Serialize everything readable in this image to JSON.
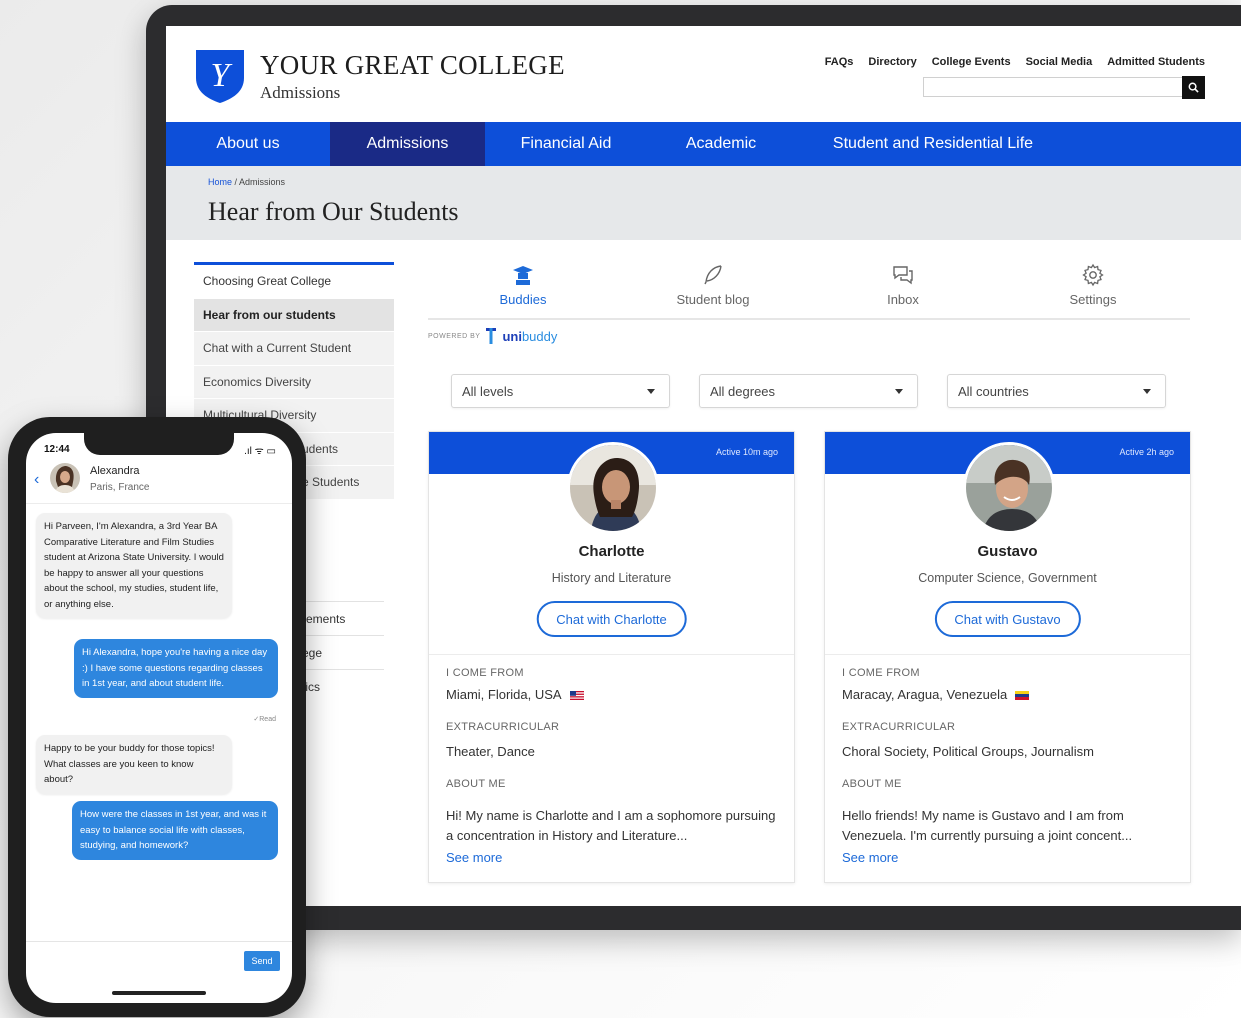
{
  "college": {
    "name": "YOUR GREAT COLLEGE",
    "subtitle": "Admissions",
    "logo_letter": "Y"
  },
  "utility_links": [
    "FAQs",
    "Directory",
    "College Events",
    "Social Media",
    "Admitted Students"
  ],
  "search": {
    "placeholder": ""
  },
  "nav": {
    "items": [
      "About us",
      "Admissions",
      "Financial Aid",
      "Academic",
      "Student and Residential Life"
    ],
    "active": "Admissions"
  },
  "breadcrumb": {
    "home": "Home",
    "current": "/ Admissions"
  },
  "page_title": "Hear from Our Students",
  "sidebar": {
    "items": [
      "Choosing Great College",
      "Hear from our students",
      "Chat with a Current Student",
      "Economics Diversity",
      "Multicultural Diversity",
      "udents",
      "e Students"
    ],
    "lower_items": [
      "rements",
      "ege",
      "tics"
    ]
  },
  "tabs": [
    {
      "label": "Buddies",
      "icon": "graduate-icon"
    },
    {
      "label": "Student blog",
      "icon": "feather-icon"
    },
    {
      "label": "Inbox",
      "icon": "chat-bubbles-icon"
    },
    {
      "label": "Settings",
      "icon": "gear-icon"
    }
  ],
  "powered_by": {
    "label": "POWERED BY",
    "brand_bold": "uni",
    "brand_rest": "buddy"
  },
  "filters": [
    "All levels",
    "All degrees",
    "All countries"
  ],
  "buddies": [
    {
      "name": "Charlotte",
      "subject": "History and Literature",
      "status": "Active 10m ago",
      "chat_label": "Chat with Charlotte",
      "from_label": "I COME FROM",
      "from": "Miami, Florida, USA",
      "flag": "us-flag-icon",
      "extra_label": "EXTRACURRICULAR",
      "extracurricular": "Theater, Dance",
      "about_label": "ABOUT ME",
      "about": "Hi! My name is Charlotte and I am a sophomore pursuing a concentration in History and Literature...",
      "see_more": "See more"
    },
    {
      "name": "Gustavo",
      "subject": "Computer Science, Government",
      "status": "Active 2h ago",
      "chat_label": "Chat with Gustavo",
      "from_label": "I COME FROM",
      "from": "Maracay, Aragua, Venezuela",
      "flag": "venezuela-flag-icon",
      "extra_label": "EXTRACURRICULAR",
      "extracurricular": "Choral Society, Political Groups, Journalism",
      "about_label": "ABOUT ME",
      "about": "Hello friends! My name is Gustavo and I am from Venezuela. I'm currently pursuing a joint concent...",
      "see_more": "See more"
    }
  ],
  "phone": {
    "time": "12:44",
    "status_icons": ".ıl ᯤ ▭",
    "contact_name": "Alexandra",
    "contact_location": "Paris, France",
    "messages": [
      {
        "from": "in",
        "text": "Hi Parveen, I'm Alexandra, a 3rd Year BA Comparative Literature and Film Studies student at Arizona State University. I would be happy to answer all your questions about the school, my studies, student life, or anything else."
      },
      {
        "from": "out",
        "text": "Hi Alexandra, hope you're having a nice day :) I have some questions regarding classes in 1st year, and about student life."
      },
      {
        "from": "in",
        "text": "Happy to be your buddy for those topics! What classes are you keen to know about?"
      },
      {
        "from": "out",
        "text": "How were the classes in 1st year, and was it easy to balance social life with classes, studying, and homework?"
      }
    ],
    "read_receipt": "✓Read",
    "send_label": "Send"
  },
  "colors": {
    "brand_blue": "#0d4fd9",
    "active_nav": "#1a2a86",
    "link_blue": "#1d6ad8",
    "bubble_blue": "#2e86de"
  }
}
